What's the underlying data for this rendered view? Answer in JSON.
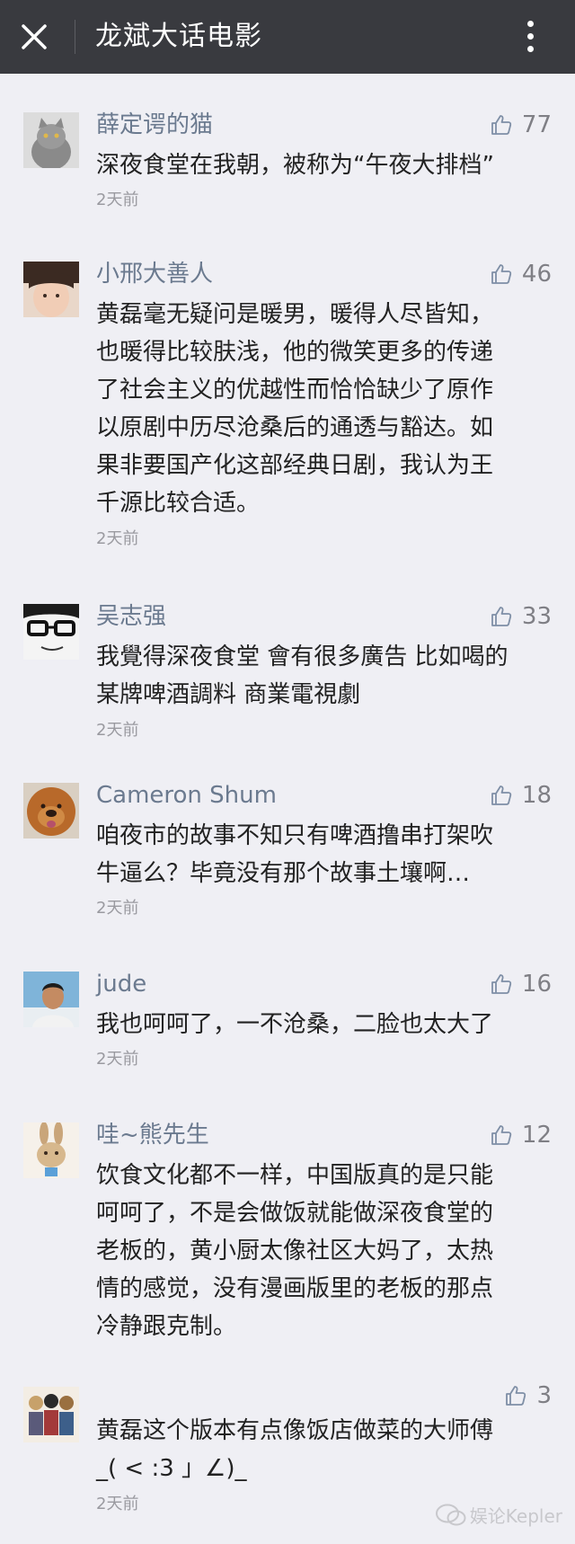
{
  "header": {
    "title": "龙斌大话电影",
    "close_icon": "close-icon",
    "more_icon": "more-vertical-icon",
    "background": "#393a3f"
  },
  "comments": [
    {
      "name": "薛定谔的猫",
      "likes": "77",
      "text": "深夜食堂在我朝，被称为“午夜大排档”",
      "time": "2天前",
      "avatar": "cat-avatar"
    },
    {
      "name": "小邢大善人",
      "likes": "46",
      "text": "黄磊毫无疑问是暖男，暖得人尽皆知，\n也暖得比较肤浅，他的微笑更多的传递\n了社会主义的优越性而恰恰缺少了原作\n以原剧中历尽沧桑后的通透与豁达。如\n果非要国产化这部经典日剧，我认为王\n千源比较合适。",
      "time": "2天前",
      "avatar": "girl-avatar"
    },
    {
      "name": "吴志强",
      "likes": "33",
      "text": "我覺得深夜食堂 會有很多廣告 比如喝的\n某牌啤酒調料 商業電視劇",
      "time": "2天前",
      "avatar": "glasses-avatar"
    },
    {
      "name": "Cameron Shum",
      "likes": "18",
      "text": "咱夜市的故事不知只有啤酒撸串打架吹\n牛逼么？毕竟没有那个故事土壤啊…",
      "time": "2天前",
      "avatar": "dog-avatar"
    },
    {
      "name": "jude",
      "likes": "16",
      "text": "我也呵呵了，一不沧桑，二脸也太大了",
      "time": "2天前",
      "avatar": "man-avatar"
    },
    {
      "name": "哇~熊先生",
      "likes": "12",
      "text": "饮食文化都不一样，中国版真的是只能\n呵呵了，不是会做饭就能做深夜食堂的\n老板的，黄小厨太像社区大妈了，太热\n情的感觉，没有漫画版里的老板的那点\n冷静跟克制。",
      "time": "",
      "avatar": "rabbit-avatar"
    },
    {
      "name": "",
      "likes": "3",
      "text": "黄磊这个版本有点像饭店做菜的大师傅\n_( <  :3 」∠)_",
      "time": "2天前",
      "avatar": "anime-avatar"
    }
  ],
  "watermark": {
    "text": "娱论Kepler",
    "icon": "wechat-icon"
  },
  "colors": {
    "name": "#6b7a8f",
    "like": "#7f7f85",
    "text": "#222222",
    "time": "#9a9aa0",
    "background": "#efeff4"
  }
}
